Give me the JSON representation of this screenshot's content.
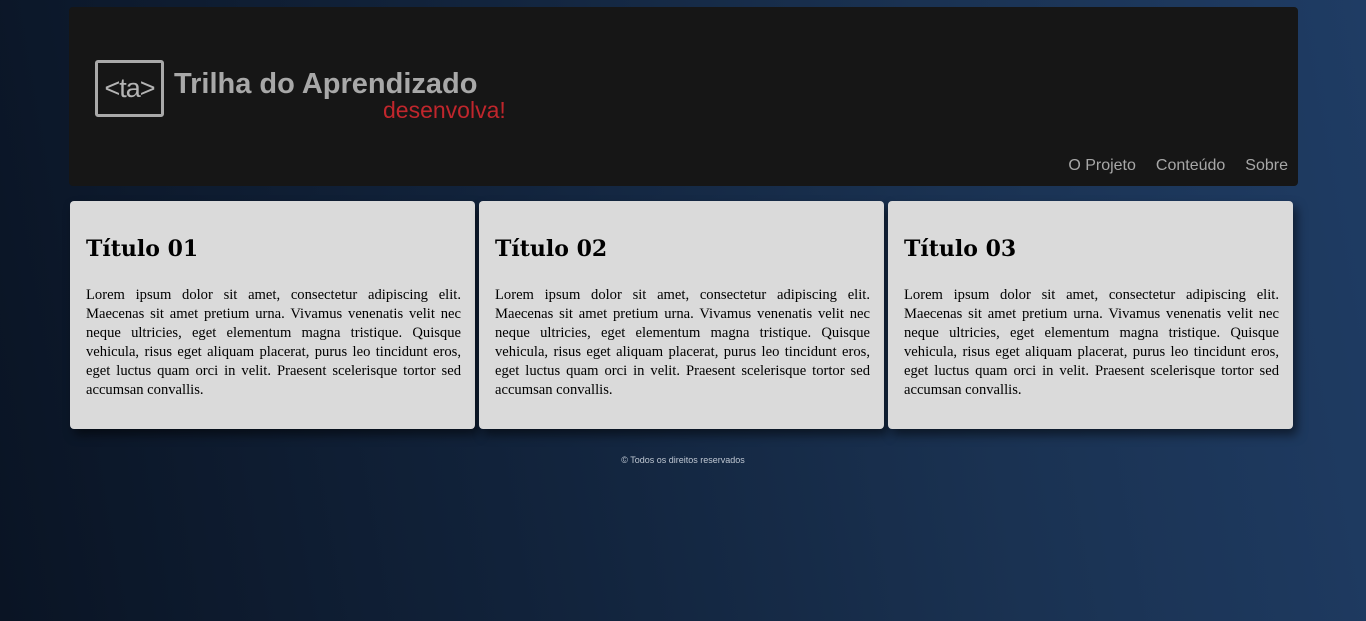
{
  "header": {
    "logo": {
      "mark": "<ta>",
      "title": "Trilha do Aprendizado",
      "tagline": "desenvolva!"
    },
    "nav": [
      {
        "label": "O Projeto"
      },
      {
        "label": "Conteúdo"
      },
      {
        "label": "Sobre"
      }
    ]
  },
  "cards": [
    {
      "title": "Título 01",
      "text": "Lorem ipsum dolor sit amet, consectetur adipiscing elit. Maecenas sit amet pretium urna. Vivamus venenatis velit nec neque ultricies, eget elementum magna tristique. Quisque vehicula, risus eget aliquam placerat, purus leo tincidunt eros, eget luctus quam orci in velit. Praesent scelerisque tortor sed accumsan convallis."
    },
    {
      "title": "Título 02",
      "text": "Lorem ipsum dolor sit amet, consectetur adipiscing elit. Maecenas sit amet pretium urna. Vivamus venenatis velit nec neque ultricies, eget elementum magna tristique. Quisque vehicula, risus eget aliquam placerat, purus leo tincidunt eros, eget luctus quam orci in velit. Praesent scelerisque tortor sed accumsan convallis."
    },
    {
      "title": "Título 03",
      "text": "Lorem ipsum dolor sit amet, consectetur adipiscing elit. Maecenas sit amet pretium urna. Vivamus venenatis velit nec neque ultricies, eget elementum magna tristique. Quisque vehicula, risus eget aliquam placerat, purus leo tincidunt eros, eget luctus quam orci in velit. Praesent scelerisque tortor sed accumsan convallis."
    }
  ],
  "footer": {
    "text": "© Todos os direitos reservados"
  },
  "colors": {
    "header_bg": "#161616",
    "card_bg": "#dadada",
    "logo_gray": "#a8a8a8",
    "tagline_red": "#c0262c"
  }
}
